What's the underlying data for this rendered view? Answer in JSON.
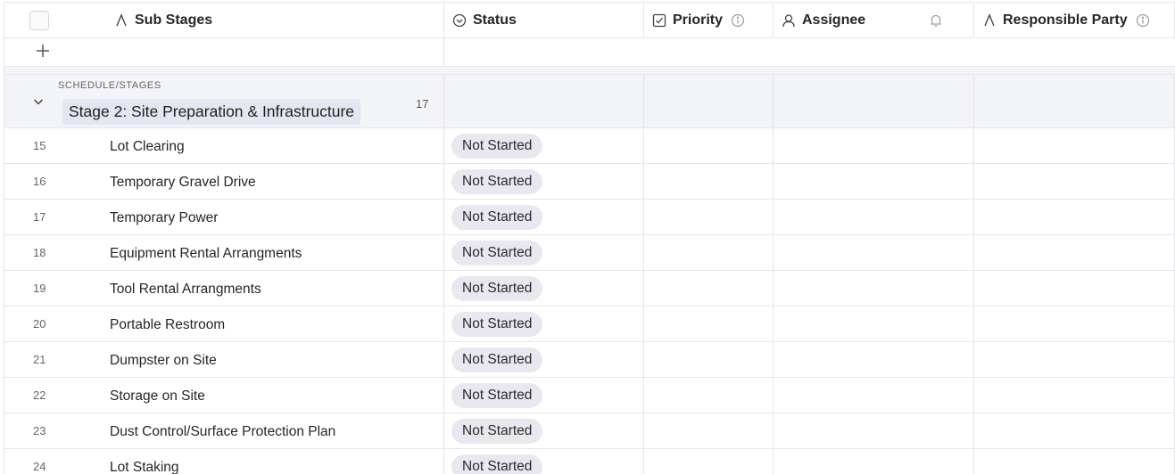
{
  "header": {
    "sub_stages": "Sub Stages",
    "status": "Status",
    "priority": "Priority",
    "assignee": "Assignee",
    "responsible_party": "Responsible Party"
  },
  "add_row": {
    "icon": "plus-icon"
  },
  "group": {
    "path": "SCHEDULE/STAGES",
    "title": "Stage 2: Site Preparation & Infrastructure",
    "count": "17"
  },
  "rows": [
    {
      "num": "15",
      "name": "Lot Clearing",
      "status": "Not Started"
    },
    {
      "num": "16",
      "name": "Temporary Gravel Drive",
      "status": "Not Started"
    },
    {
      "num": "17",
      "name": "Temporary Power",
      "status": "Not Started"
    },
    {
      "num": "18",
      "name": "Equipment Rental Arrangments",
      "status": "Not Started"
    },
    {
      "num": "19",
      "name": "Tool Rental Arrangments",
      "status": "Not Started"
    },
    {
      "num": "20",
      "name": "Portable Restroom",
      "status": "Not Started"
    },
    {
      "num": "21",
      "name": "Dumpster on Site",
      "status": "Not Started"
    },
    {
      "num": "22",
      "name": "Storage on Site",
      "status": "Not Started"
    },
    {
      "num": "23",
      "name": "Dust Control/Surface Protection Plan",
      "status": "Not Started"
    },
    {
      "num": "24",
      "name": "Lot Staking",
      "status": "Not Started"
    }
  ]
}
